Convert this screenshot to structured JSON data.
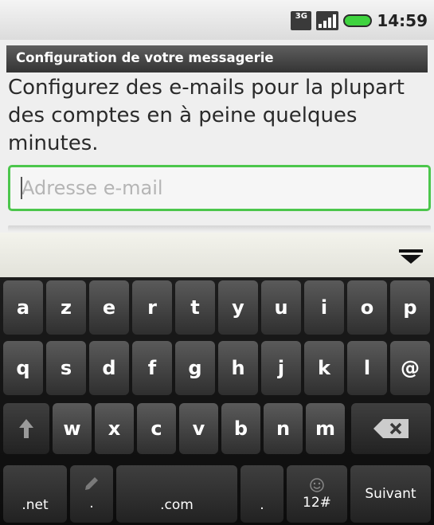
{
  "status_bar": {
    "network_type": "3G",
    "time": "14:59"
  },
  "title_bar": {
    "title": "Configuration de votre messagerie"
  },
  "main": {
    "instructions": "Configurez des e-mails pour la plupart des comptes en à peine quelques minutes.",
    "email_placeholder": "Adresse e-mail",
    "email_value": ""
  },
  "colors": {
    "focus_border": "#4cc64c",
    "battery": "#3fd33f",
    "title_bar": "#3a3a3a",
    "keyboard": "#141414"
  },
  "keyboard": {
    "row1": [
      "a",
      "z",
      "e",
      "r",
      "t",
      "y",
      "u",
      "i",
      "o",
      "p"
    ],
    "row2": [
      "q",
      "s",
      "d",
      "f",
      "g",
      "h",
      "j",
      "k",
      "l",
      "@"
    ],
    "row3": [
      "w",
      "x",
      "c",
      "v",
      "b",
      "n",
      "m"
    ],
    "shift_icon": "shift-arrow-icon",
    "backspace_icon": "backspace-icon",
    "net_label": ".net",
    "dot_label": ".",
    "com_label": ".com",
    "period_label": ".",
    "symbols_label": "12#",
    "next_label": "Suivant",
    "hide_icon": "hide-keyboard-icon"
  }
}
